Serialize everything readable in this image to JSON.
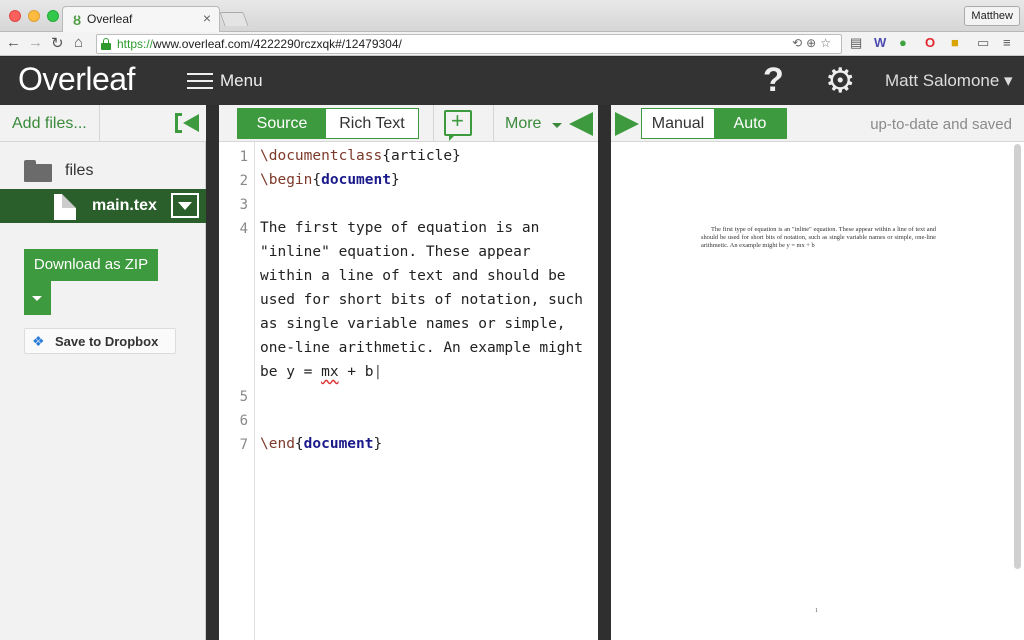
{
  "browser": {
    "tab_title": "Overleaf",
    "tab_close": "×",
    "profile": "Matthew",
    "url_scheme": "https://",
    "url_rest": "www.overleaf.com/4222290rczxqk#/12479304/",
    "nav": {
      "back": "←",
      "forward": "→",
      "reload": "↻",
      "home": "⌂"
    }
  },
  "app": {
    "logo": "Overleaf",
    "menu_label": "Menu",
    "help_glyph": "?",
    "gear_glyph": "⚙",
    "user_name": "Matt Salomone ▾"
  },
  "file_panel": {
    "add_files": "Add files...",
    "folder_label": "files",
    "selected_file": "main.tex",
    "download_zip": "Download as ZIP",
    "save_dropbox": "Save to Dropbox",
    "dropbox_glyph": "❖"
  },
  "editor_toolbar": {
    "source": "Source",
    "rich_text": "Rich Text",
    "more": "More"
  },
  "editor": {
    "line_numbers": [
      "1",
      "2",
      "3",
      "4",
      "5",
      "6",
      "7"
    ],
    "line1_cmd": "\\documentclass",
    "line1_arg": "{article}",
    "line2_cmd": "\\begin",
    "line2_arg": "document",
    "line4": [
      "The first type of equation is an",
      "\"inline\" equation. These appear",
      "within a line of text and should be",
      "used for short bits of notation, such",
      "as single variable names or simple,",
      "one-line arithmetic. An example might"
    ],
    "line4_last_pre": "be y = ",
    "line4_last_sq": "mx",
    "line4_last_post": " + b",
    "line7_cmd": "\\end",
    "line7_arg": "document"
  },
  "pdf_toolbar": {
    "manual": "Manual",
    "auto": "Auto",
    "status": "up-to-date and saved"
  },
  "pdf": {
    "body": "The first type of equation is an \"inline\" equation. These appear within a line of text and should be used for short bits of notation, such as single variable names or simple, one-line arithmetic. An example might be y = mx + b",
    "page_number": "1"
  },
  "colors": {
    "accent_green": "#3e9a3e",
    "header_dark": "#333333",
    "selected_file_bg": "#2a5e2a"
  }
}
